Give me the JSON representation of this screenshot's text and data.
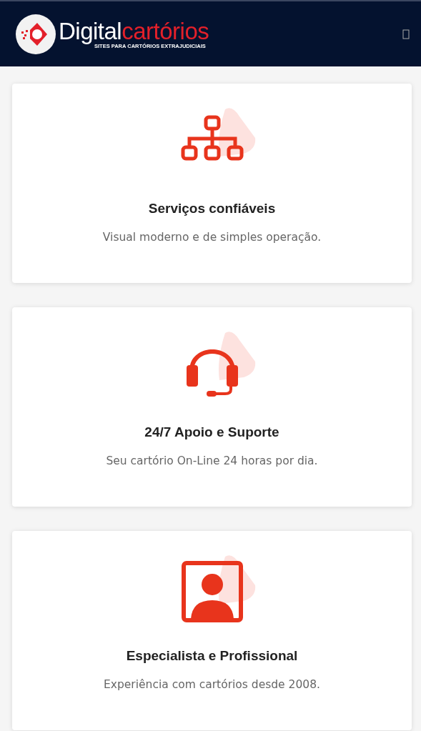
{
  "header": {
    "logo": {
      "word_1": "Digital",
      "word_2": "cartórios",
      "tagline": "SITES PARA CARTÓRIOS EXTRAJUDICIAIS"
    }
  },
  "features": [
    {
      "kind": "network",
      "title": "Serviços confiáveis",
      "text": "Visual moderno e de simples operação."
    },
    {
      "kind": "headset",
      "title": "24/7 Apoio e Suporte",
      "text": "Seu cartório On-Line 24 horas por dia."
    },
    {
      "kind": "person",
      "title": "Especialista e Profissional",
      "text": "Experiência com cartórios desde 2008."
    }
  ]
}
